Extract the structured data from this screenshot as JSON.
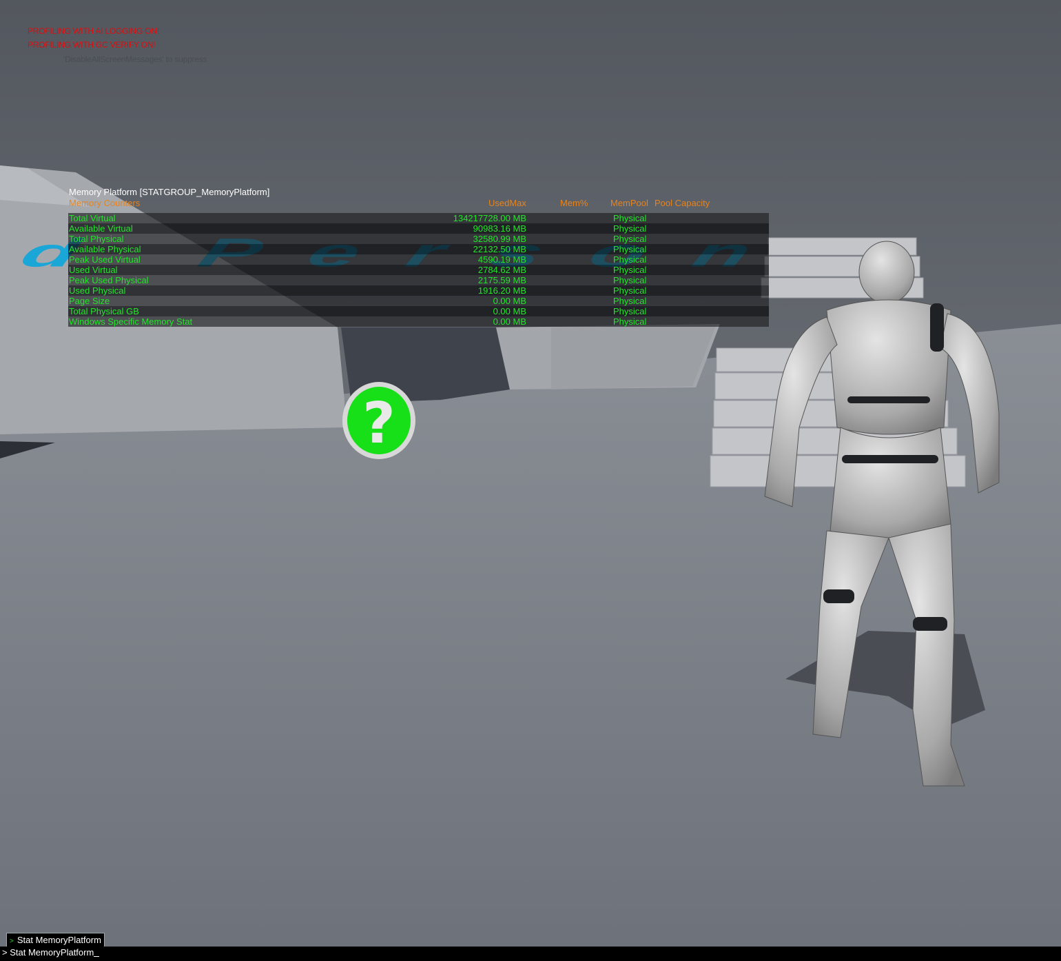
{
  "screen_messages": {
    "line1": "PROFILING WITH AI LOGGING ON!",
    "line2": "PROFILING WITH GC VERIFY ON!",
    "hint": "'DisableAllScreenMessages' to suppress"
  },
  "floor_text": "rd Person",
  "stat_group": {
    "title": "Memory Platform [STATGROUP_MemoryPlatform]",
    "headers": {
      "name": "Memory Counters",
      "used_max": "UsedMax",
      "mem_pct": "Mem%",
      "mem_pool": "MemPool",
      "pool_capacity": "Pool Capacity"
    },
    "rows": [
      {
        "name": "Total Virtual",
        "value": "134217728.00 MB",
        "pool": "Physical"
      },
      {
        "name": "Available Virtual",
        "value": "90983.16 MB",
        "pool": "Physical"
      },
      {
        "name": "Total Physical",
        "value": "32580.99 MB",
        "pool": "Physical"
      },
      {
        "name": "Available Physical",
        "value": "22132.50 MB",
        "pool": "Physical"
      },
      {
        "name": "Peak Used Virtual",
        "value": "4590.19 MB",
        "pool": "Physical"
      },
      {
        "name": "Used Virtual",
        "value": "2784.62 MB",
        "pool": "Physical"
      },
      {
        "name": "Peak Used Physical",
        "value": "2175.59 MB",
        "pool": "Physical"
      },
      {
        "name": "Used Physical",
        "value": "1916.20 MB",
        "pool": "Physical"
      },
      {
        "name": "Page Size",
        "value": "0.00 MB",
        "pool": "Physical"
      },
      {
        "name": "Total Physical GB",
        "value": "0.00 MB",
        "pool": "Physical"
      },
      {
        "name": "Windows Specific Memory Stat",
        "value": "0.00 MB",
        "pool": "Physical"
      }
    ]
  },
  "console": {
    "history_prompt": ">",
    "history_entry": "Stat MemoryPlatform",
    "input_prompt": ">",
    "input_text": "Stat MemoryPlatform"
  },
  "colors": {
    "warning": "#d80f0f",
    "stat_header": "#e7841e",
    "stat_text": "#22e629",
    "floor_text": "#1aa6d6",
    "help_icon": "#18e018"
  },
  "icons": {
    "help": "question-mark-icon"
  }
}
